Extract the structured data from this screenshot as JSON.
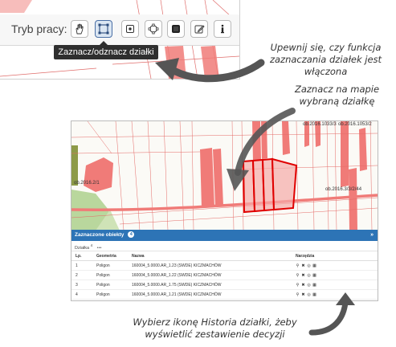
{
  "toolbar": {
    "mode_label": "Tryb pracy:",
    "tooltip": "Zaznacz/odznacz działki",
    "buttons": [
      {
        "icon": "hand-icon"
      },
      {
        "icon": "select-parcel-icon",
        "active": true
      },
      {
        "icon": "point-select-icon"
      },
      {
        "icon": "polygon-select-icon"
      },
      {
        "icon": "square-stop-icon"
      },
      {
        "icon": "edit-icon"
      },
      {
        "icon": "info-icon"
      }
    ]
  },
  "notes": {
    "note1": "Upewnij się, czy funkcja\nzaznaczania działek jest włączona",
    "note2": "Zaznacz na mapie\nwybraną działkę",
    "note3": "Wybierz ikonę Historia działki, żeby\nwyświetlić zestawienie decyzji"
  },
  "map": {
    "labels": {
      "l1": "ob.2016.2/1",
      "l2": "ob.2016.1033/3",
      "l3": "ob.2016.1053/2",
      "l4": "ob.2016.3/3/2/44"
    }
  },
  "panel": {
    "title": "Zaznaczone obiekty",
    "count": "4",
    "tab": "Działka",
    "tab_count": "4",
    "tab_menu": "•••",
    "columns": [
      "Lp.",
      "Geometria",
      "Nazwa",
      "Narzędzia"
    ],
    "rows": [
      {
        "lp": "1",
        "geom": "Poligon",
        "name": "160004_5.0000.AR_1.23 (SWDE) KICZMACHÓW"
      },
      {
        "lp": "2",
        "geom": "Poligon",
        "name": "160004_5.0000.AR_1.22 (SWDE) KICZMACHÓW"
      },
      {
        "lp": "3",
        "geom": "Poligon",
        "name": "160004_5.0000.AR_1.75 (SWDE) KICZMACHÓW"
      },
      {
        "lp": "4",
        "geom": "Poligon",
        "name": "160004_5.0000.AR_1.21 (SWDE) KICZMACHÓW"
      }
    ],
    "tool_icons": [
      "zoom-icon",
      "remove-icon",
      "locate-icon",
      "history-icon"
    ]
  },
  "colors": {
    "accent": "#2d74b6",
    "parcel_fill": "#f07b78",
    "parcel_line": "#e0433f",
    "selection": "#e00000"
  }
}
